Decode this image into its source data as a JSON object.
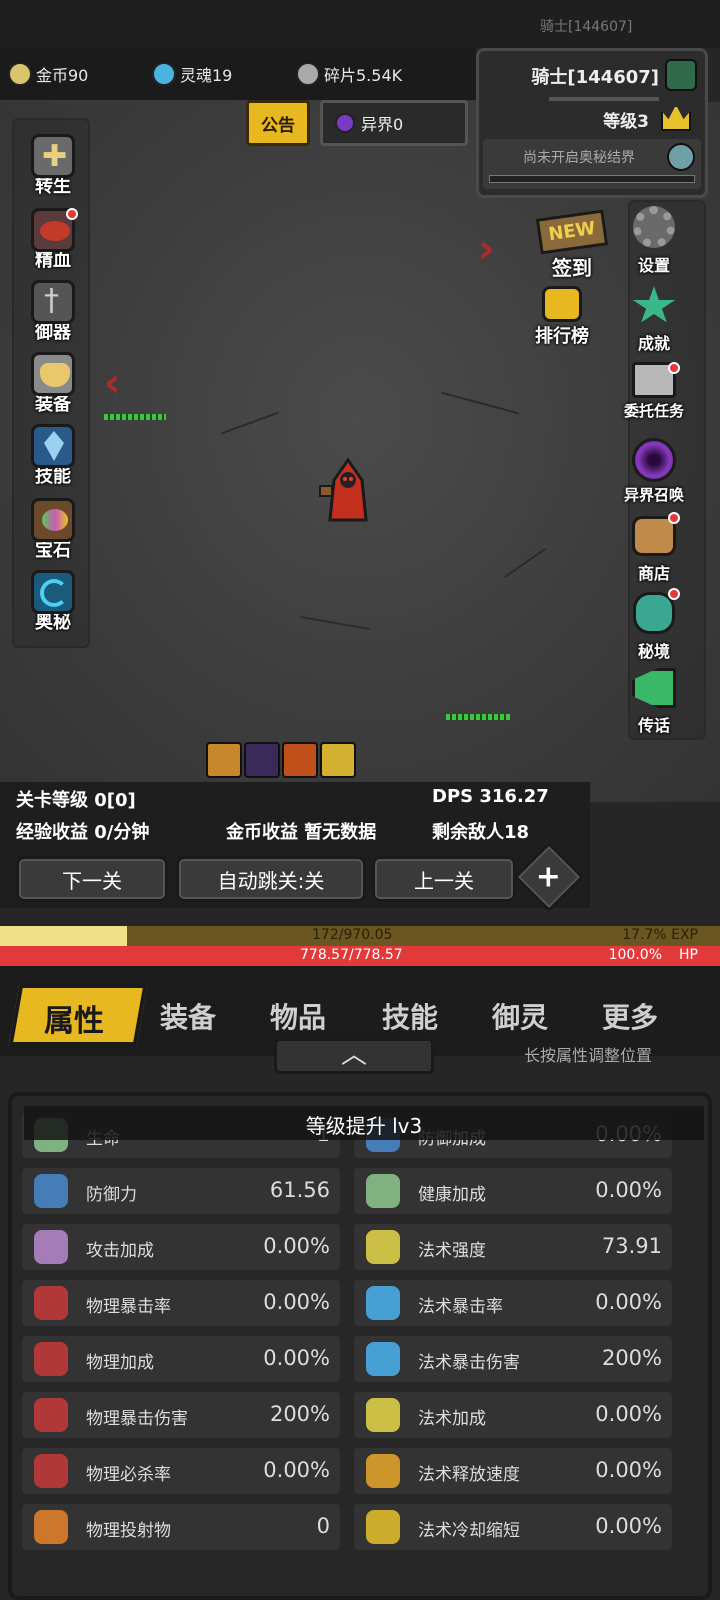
{
  "status": {
    "player_id": "骑士[144607]"
  },
  "resources": {
    "gold": "金币90",
    "soul": "灵魂19",
    "fragments": "碎片5.54K"
  },
  "notice": {
    "label": "公告"
  },
  "otherworld": {
    "label": "异界0"
  },
  "character": {
    "name": "骑士[144607]",
    "level": "等级3",
    "secret_realm": "尚未开启奥秘结界"
  },
  "left_menu": [
    "转生",
    "精血",
    "御器",
    "装备",
    "技能",
    "宝石",
    "奥秘"
  ],
  "right_menu": {
    "checkin_badge": "NEW",
    "checkin": "签到",
    "rank": "排行榜",
    "settings": "设置",
    "achievements": "成就",
    "commission": "委托任务",
    "summon": "异界召唤",
    "shop": "商店",
    "secret": "秘境",
    "teleport": "传话"
  },
  "stage": {
    "level": "关卡等级 0[0]",
    "dps": "DPS 316.27",
    "exp_income": "经验收益 0/分钟",
    "gold_income": "金币收益 暂无数据",
    "enemies": "剩余敌人18"
  },
  "buttons": {
    "next": "下一关",
    "auto": "自动跳关:关",
    "prev": "上一关",
    "plus": "+"
  },
  "exp": {
    "value": "172/970.05",
    "percent": "17.7% EXP",
    "fill": 0.177
  },
  "hp": {
    "value": "778.57/778.57",
    "percent": "100.0%",
    "label": "HP",
    "fill": 1.0
  },
  "tabs": [
    "属性",
    "装备",
    "物品",
    "技能",
    "御灵",
    "更多"
  ],
  "hint": "长按属性调整位置",
  "toast": "等级提升 lv3",
  "stats_left": [
    {
      "name": "生命",
      "value": "1"
    },
    {
      "name": "防御力",
      "value": "61.56"
    },
    {
      "name": "攻击加成",
      "value": "0.00%"
    },
    {
      "name": "物理暴击率",
      "value": "0.00%"
    },
    {
      "name": "物理加成",
      "value": "0.00%"
    },
    {
      "name": "物理暴击伤害",
      "value": "200%"
    },
    {
      "name": "物理必杀率",
      "value": "0.00%"
    },
    {
      "name": "物理投射物",
      "value": "0"
    }
  ],
  "stats_right": [
    {
      "name": "防御加成",
      "value": "0.00%"
    },
    {
      "name": "健康加成",
      "value": "0.00%"
    },
    {
      "name": "法术强度",
      "value": "73.91"
    },
    {
      "name": "法术暴击率",
      "value": "0.00%"
    },
    {
      "name": "法术暴击伤害",
      "value": "200%"
    },
    {
      "name": "法术加成",
      "value": "0.00%"
    },
    {
      "name": "法术释放速度",
      "value": "0.00%"
    },
    {
      "name": "法术冷却缩短",
      "value": "0.00%"
    }
  ]
}
